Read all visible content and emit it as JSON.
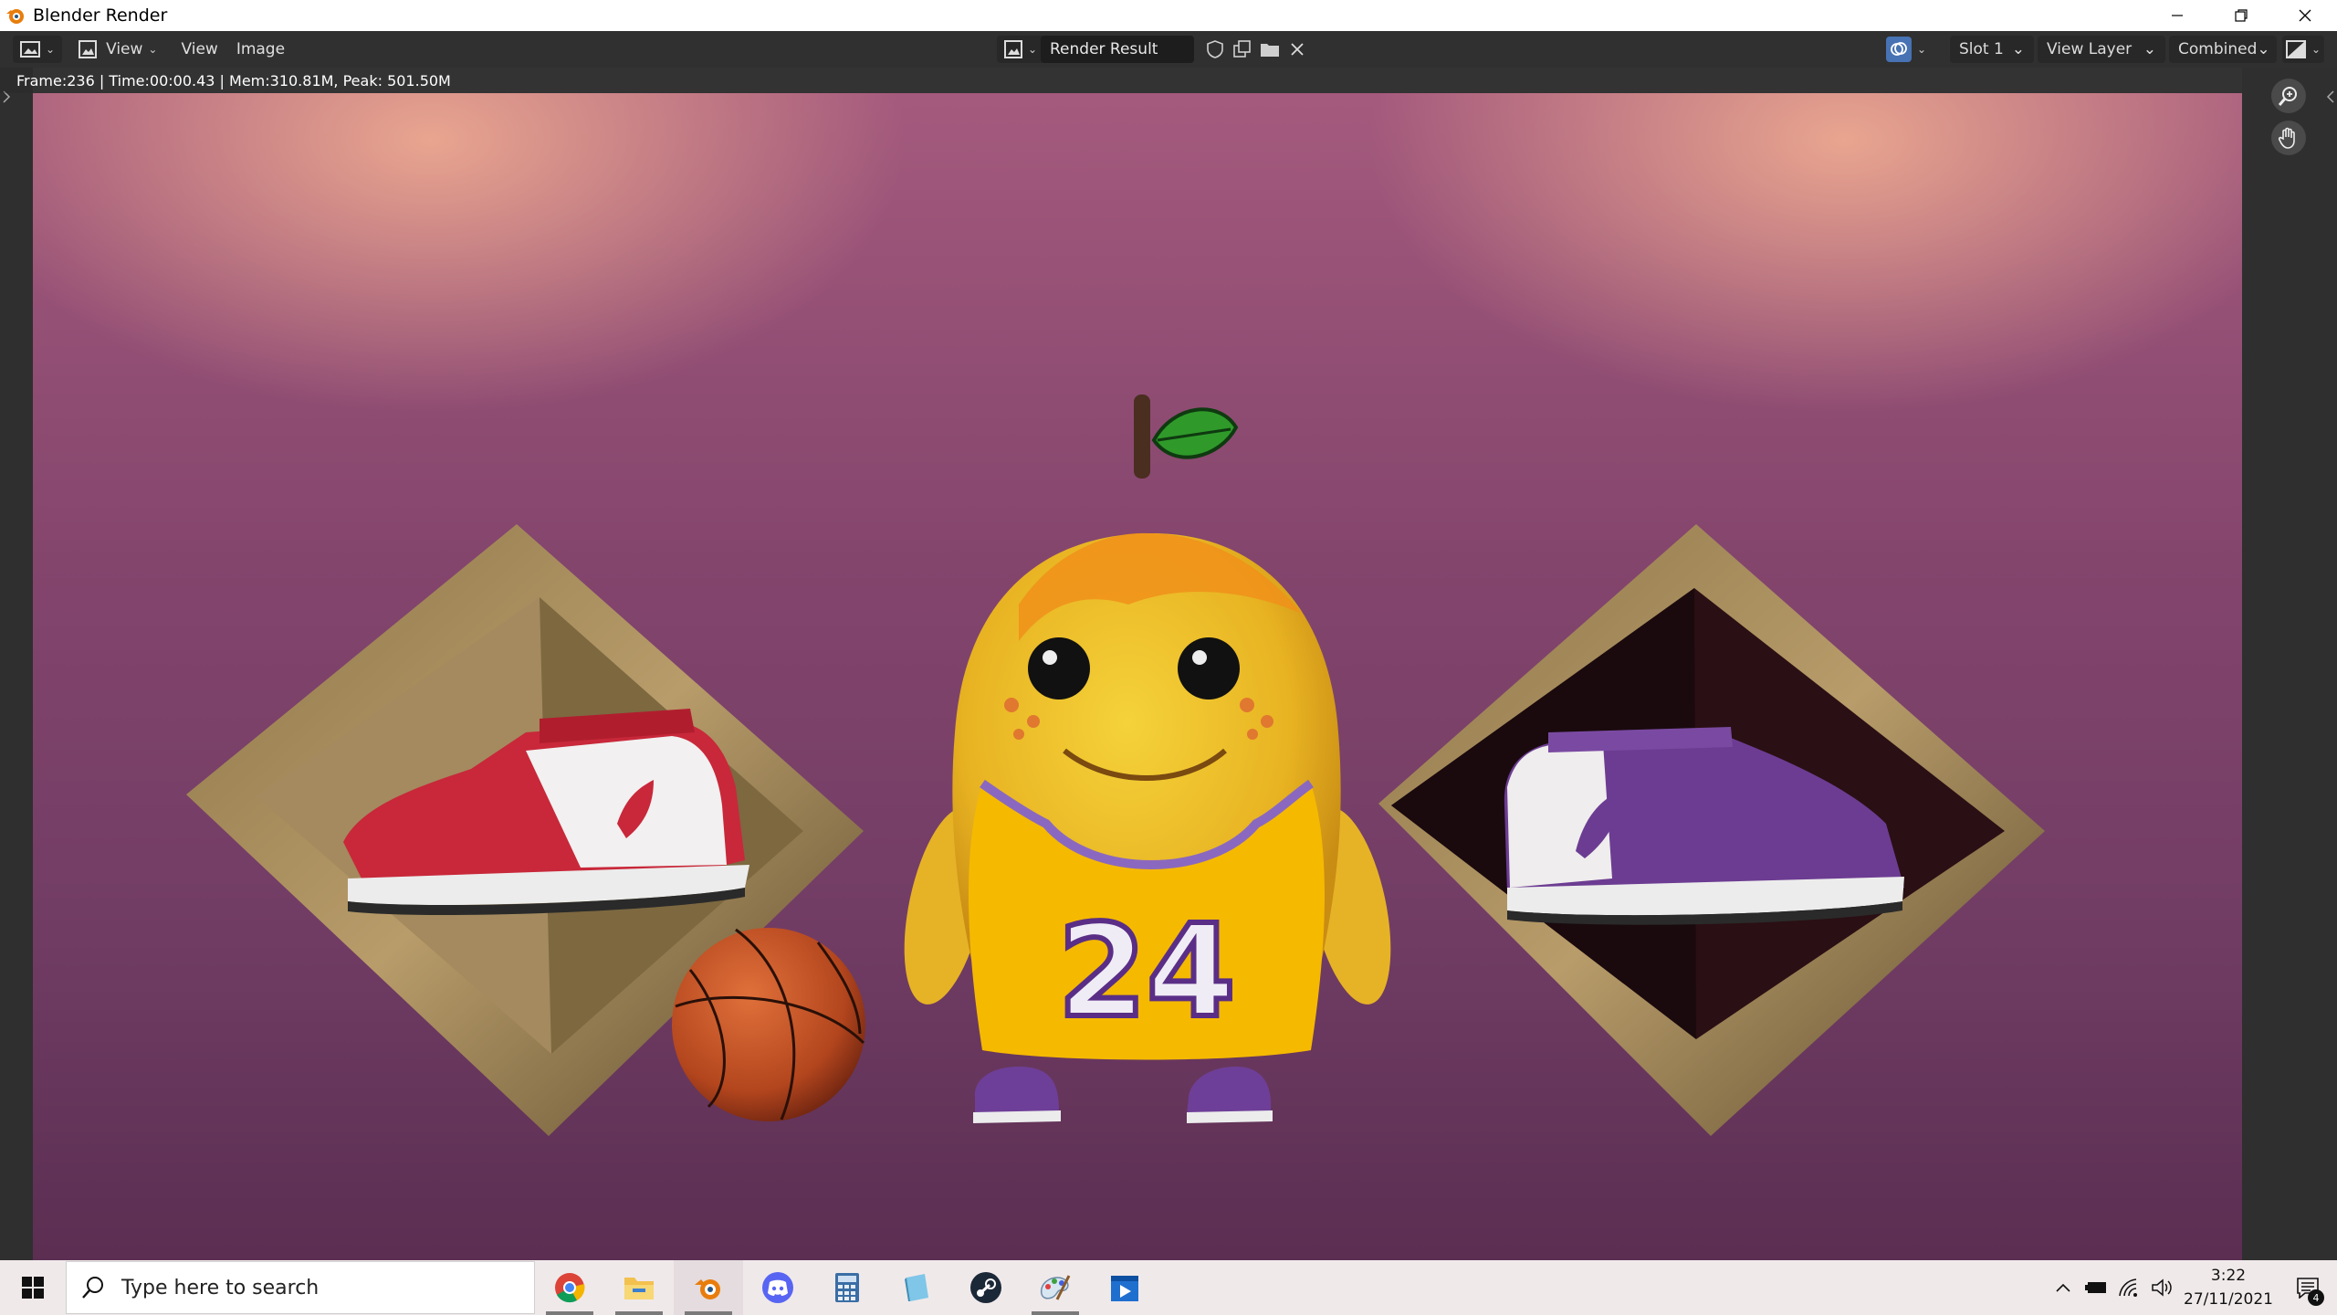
{
  "window": {
    "title": "Blender Render"
  },
  "header": {
    "menus": {
      "view_dropdown": "View",
      "view": "View",
      "image": "Image"
    },
    "image_name": "Render Result",
    "slot": "Slot 1",
    "view_layer": "View Layer",
    "pass": "Combined"
  },
  "viewport": {
    "info": "Frame:236 | Time:00:00.43 | Mem:310.81M, Peak: 501.50M",
    "jersey_number": "24"
  },
  "taskbar": {
    "search_placeholder": "Type here to search",
    "apps": [
      "chrome-icon",
      "file-explorer-icon",
      "blender-icon",
      "discord-icon",
      "calculator-icon",
      "notepad-icon",
      "steam-icon",
      "paint-icon",
      "media-player-icon"
    ],
    "time": "3:22",
    "date": "27/11/2021",
    "notification_count": "4"
  },
  "colors": {
    "header_bg": "#303030",
    "accent": "#4772b3",
    "background_top": "#a45a7d",
    "background_bottom": "#5b2e52"
  }
}
